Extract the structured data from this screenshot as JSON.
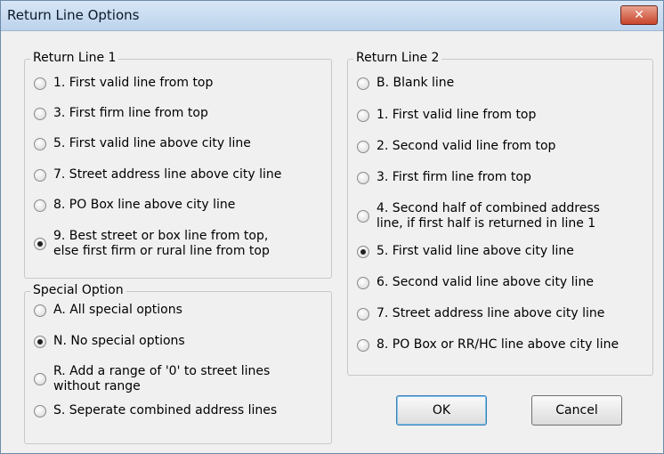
{
  "window": {
    "title": "Return Line Options",
    "close_glyph": "✕"
  },
  "return_line_1": {
    "label": "Return Line 1",
    "options": [
      {
        "text": "1. First valid line from top",
        "checked": false
      },
      {
        "text": "3. First firm line from top",
        "checked": false
      },
      {
        "text": "5. First valid line above city line",
        "checked": false
      },
      {
        "text": "7. Street address line above city line",
        "checked": false
      },
      {
        "text": "8. PO Box line above city line",
        "checked": false
      },
      {
        "text": "9. Best street or box line from top,",
        "text2": "else first firm or rural line from top",
        "checked": true
      }
    ]
  },
  "special_option": {
    "label": "Special Option",
    "options": [
      {
        "text": "A. All special options",
        "checked": false
      },
      {
        "text": "N. No special options",
        "checked": true
      },
      {
        "text": "R. Add a range of '0' to street lines",
        "text2": "without range",
        "checked": false
      },
      {
        "text": "S. Seperate combined address lines",
        "checked": false
      }
    ]
  },
  "return_line_2": {
    "label": "Return Line 2",
    "options": [
      {
        "text": "B. Blank line",
        "checked": false
      },
      {
        "text": "1. First valid line from top",
        "checked": false
      },
      {
        "text": "2. Second valid line from top",
        "checked": false
      },
      {
        "text": "3. First firm line from top",
        "checked": false
      },
      {
        "text": "4. Second half of combined address",
        "text2": "line, if first half is returned in line 1",
        "checked": false
      },
      {
        "text": "5. First valid line above city line",
        "checked": true
      },
      {
        "text": "6. Second valid line above city line",
        "checked": false
      },
      {
        "text": "7. Street address line above city line",
        "checked": false
      },
      {
        "text": "8. PO Box or RR/HC line above city line",
        "checked": false
      }
    ]
  },
  "buttons": {
    "ok": "OK",
    "cancel": "Cancel"
  }
}
